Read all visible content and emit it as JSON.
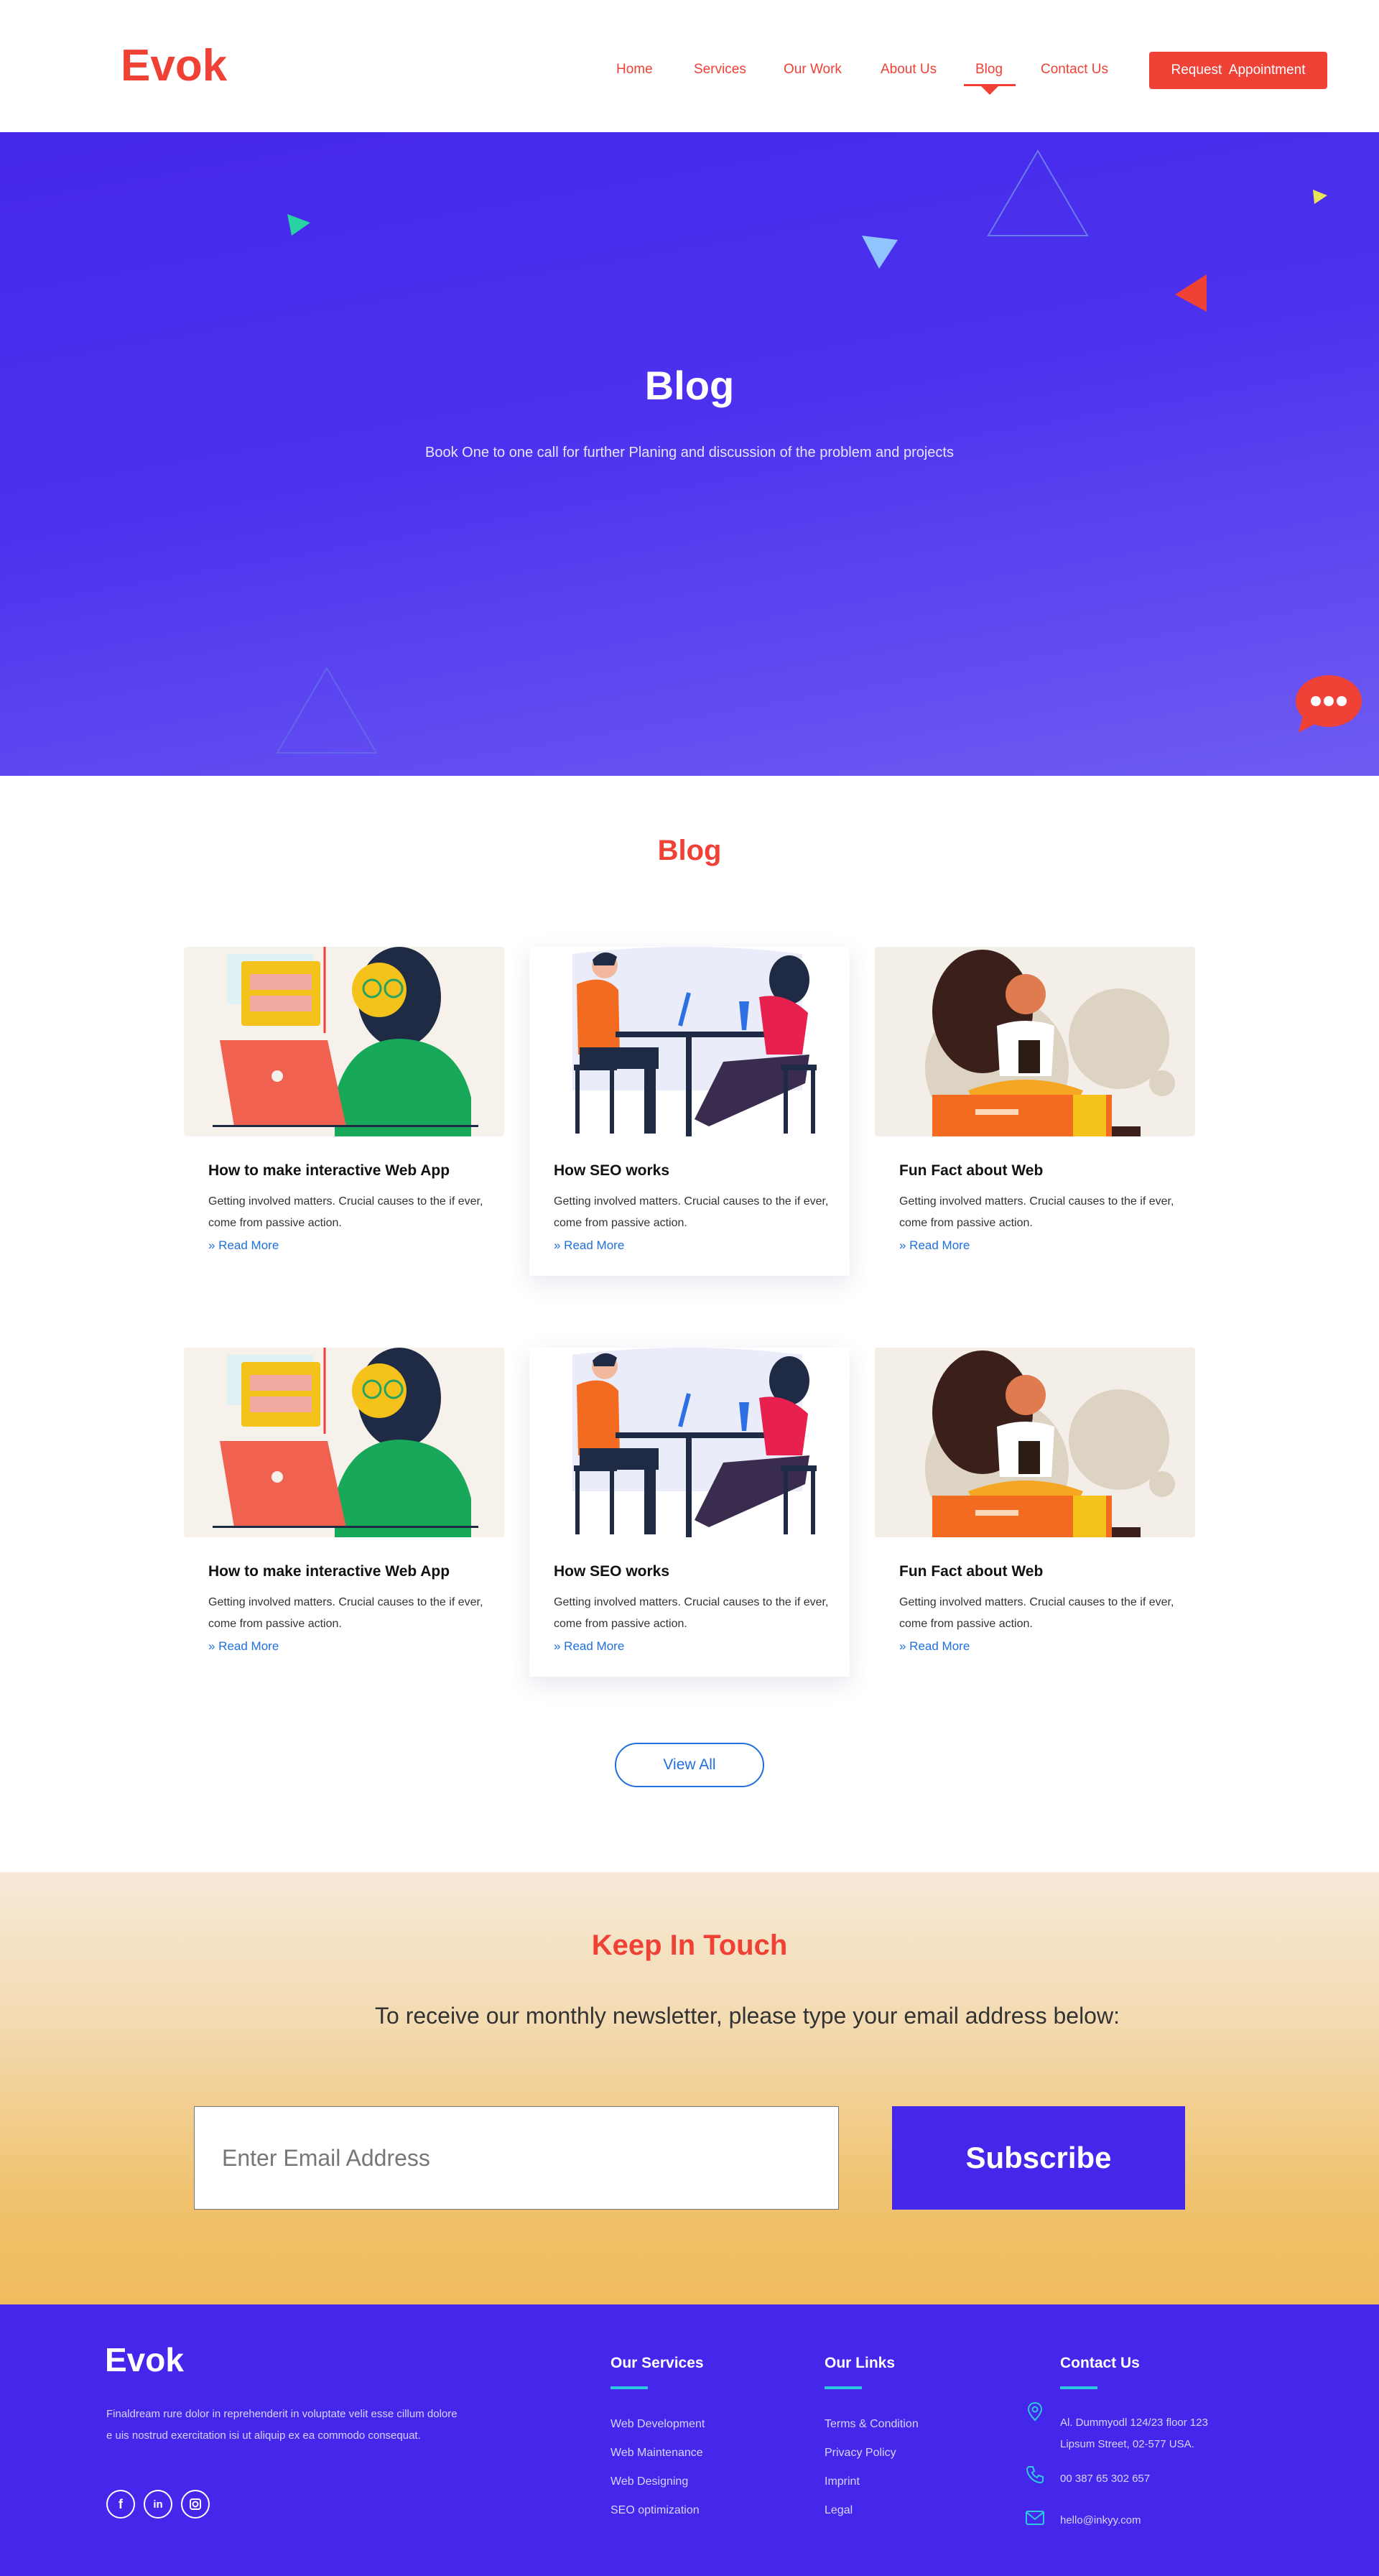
{
  "header": {
    "logo": "Evok",
    "nav": [
      "Home",
      "Services",
      "Our Work",
      "About Us",
      "Blog",
      "Contact Us"
    ],
    "active_nav": "Blog",
    "cta_label": "Request  Appointment"
  },
  "hero": {
    "title": "Blog",
    "subtitle": "Book One to one call for further Planing and discussion of the problem and projects"
  },
  "blog": {
    "heading": "Blog",
    "cards": [
      {
        "title": "How to make interactive Web App",
        "text": "Getting involved matters. Crucial causes to the if ever, come from passive action.",
        "link": "» Read More",
        "image": "woman-with-laptop-illustration"
      },
      {
        "title": "How SEO works",
        "text": "Getting involved matters. Crucial causes to the if ever, come from passive action.",
        "link": "» Read More",
        "image": "two-people-at-table-illustration"
      },
      {
        "title": "Fun Fact about Web",
        "text": "Getting involved matters. Crucial causes to the if ever, come from passive action.",
        "link": "» Read More",
        "image": "woman-reading-book-illustration"
      },
      {
        "title": "How to make interactive Web App",
        "text": "Getting involved matters. Crucial causes to the if ever, come from passive action.",
        "link": "» Read More",
        "image": "woman-with-laptop-illustration"
      },
      {
        "title": "How SEO works",
        "text": "Getting involved matters. Crucial causes to the if ever, come from passive action.",
        "link": "» Read More",
        "image": "two-people-at-table-illustration"
      },
      {
        "title": "Fun Fact about Web",
        "text": "Getting involved matters. Crucial causes to the if ever, come from passive action.",
        "link": "» Read More",
        "image": "woman-reading-book-illustration"
      }
    ],
    "view_all": "View All"
  },
  "newsletter": {
    "title": "Keep In Touch",
    "text": "To receive our monthly newsletter, please type your email address below:",
    "placeholder": "Enter Email Address",
    "button": "Subscribe"
  },
  "footer": {
    "logo": "Evok",
    "about": "Finaldream rure dolor in reprehenderit in voluptate velit esse cillum dolore e uis nostrud exercitation isi ut aliquip ex ea commodo consequat.",
    "social": [
      "f",
      "in",
      "ig"
    ],
    "services": {
      "title": "Our Services",
      "items": [
        "Web Development",
        "Web Maintenance",
        "Web Designing",
        "SEO optimization"
      ]
    },
    "links": {
      "title": "Our Links",
      "items": [
        "Terms & Condition",
        "Privacy Policy",
        "Imprint",
        "Legal"
      ]
    },
    "contact": {
      "title": "Contact Us",
      "address_line1": "Al. Dummyodl 124/23 floor 123",
      "address_line2": "Lipsum Street, 02-577 USA.",
      "phone": "00 387 65 302 657",
      "email": "hello@inkyy.com"
    }
  },
  "colors": {
    "brand_red": "#ef4136",
    "brand_blue": "#4427ea",
    "link_blue": "#1f6fdc",
    "accent_teal": "#2ec8e0"
  }
}
